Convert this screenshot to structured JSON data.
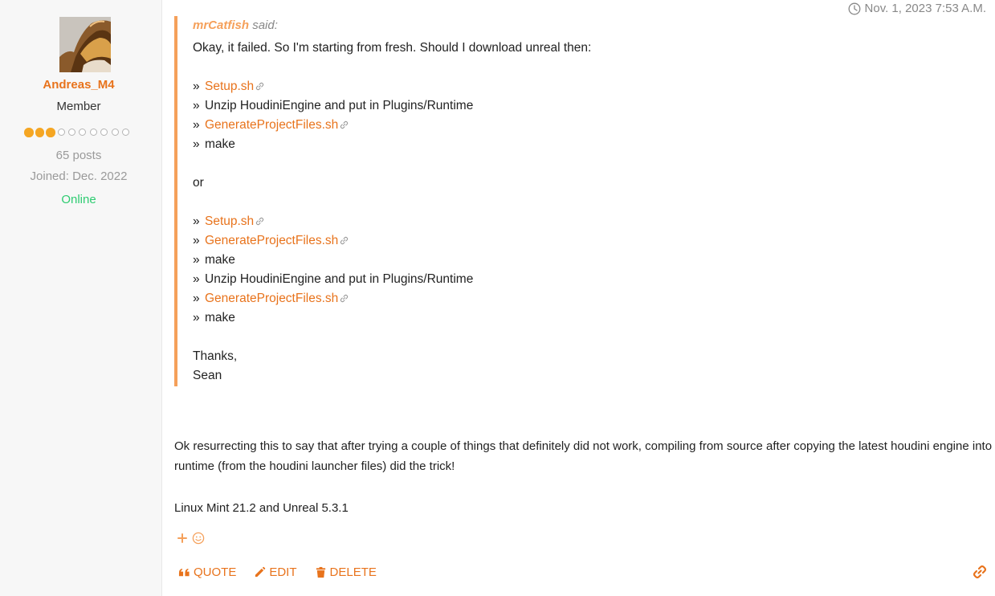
{
  "author": {
    "name": "Andreas_M4",
    "role": "Member",
    "rank_filled": 3,
    "rank_total": 10,
    "posts": "65 posts",
    "joined": "Joined: Dec. 2022",
    "status": "Online"
  },
  "post": {
    "timestamp": "Nov. 1, 2023 7:53 A.M.",
    "quote": {
      "author": "mrCatfish",
      "said": "said:",
      "intro": "Okay, it failed. So I'm starting from fresh. Should I download unreal then:",
      "list_a": [
        {
          "text": "Setup.sh",
          "link": true
        },
        {
          "text": "Unzip HoudiniEngine and put in Plugins/Runtime",
          "link": false
        },
        {
          "text": "GenerateProjectFiles.sh",
          "link": true
        },
        {
          "text": "make",
          "link": false
        }
      ],
      "or": "or",
      "list_b": [
        {
          "text": "Setup.sh",
          "link": true
        },
        {
          "text": "GenerateProjectFiles.sh",
          "link": true
        },
        {
          "text": "make",
          "link": false
        },
        {
          "text": "Unzip HoudiniEngine and put in Plugins/Runtime",
          "link": false
        },
        {
          "text": "GenerateProjectFiles.sh",
          "link": true
        },
        {
          "text": "make",
          "link": false
        }
      ],
      "bullet": "»",
      "thanks": "Thanks,",
      "signature": "Sean"
    },
    "body_line1": "Ok resurrecting this to say that after trying a couple of things that definitely did not work, compiling from source after copying the latest houdini engine into",
    "body_line2": "runtime (from the houdini launcher files) did the trick!",
    "body_line3": "Linux Mint 21.2 and Unreal 5.3.1"
  },
  "actions": {
    "quote": "QUOTE",
    "edit": "EDIT",
    "delete": "DELETE"
  },
  "icons": {
    "timestamp": "clock-icon",
    "reaction_add": "plus-icon",
    "reaction_emoji": "smiley-icon",
    "quote": "quote-icon",
    "edit": "pencil-icon",
    "delete": "trash-icon",
    "permalink": "link-icon",
    "quote_link": "chain-link-icon"
  },
  "colors": {
    "accent": "#e8731c",
    "quote_border": "#f5a05a",
    "rank": "#f5a623",
    "online": "#2ecc71"
  }
}
